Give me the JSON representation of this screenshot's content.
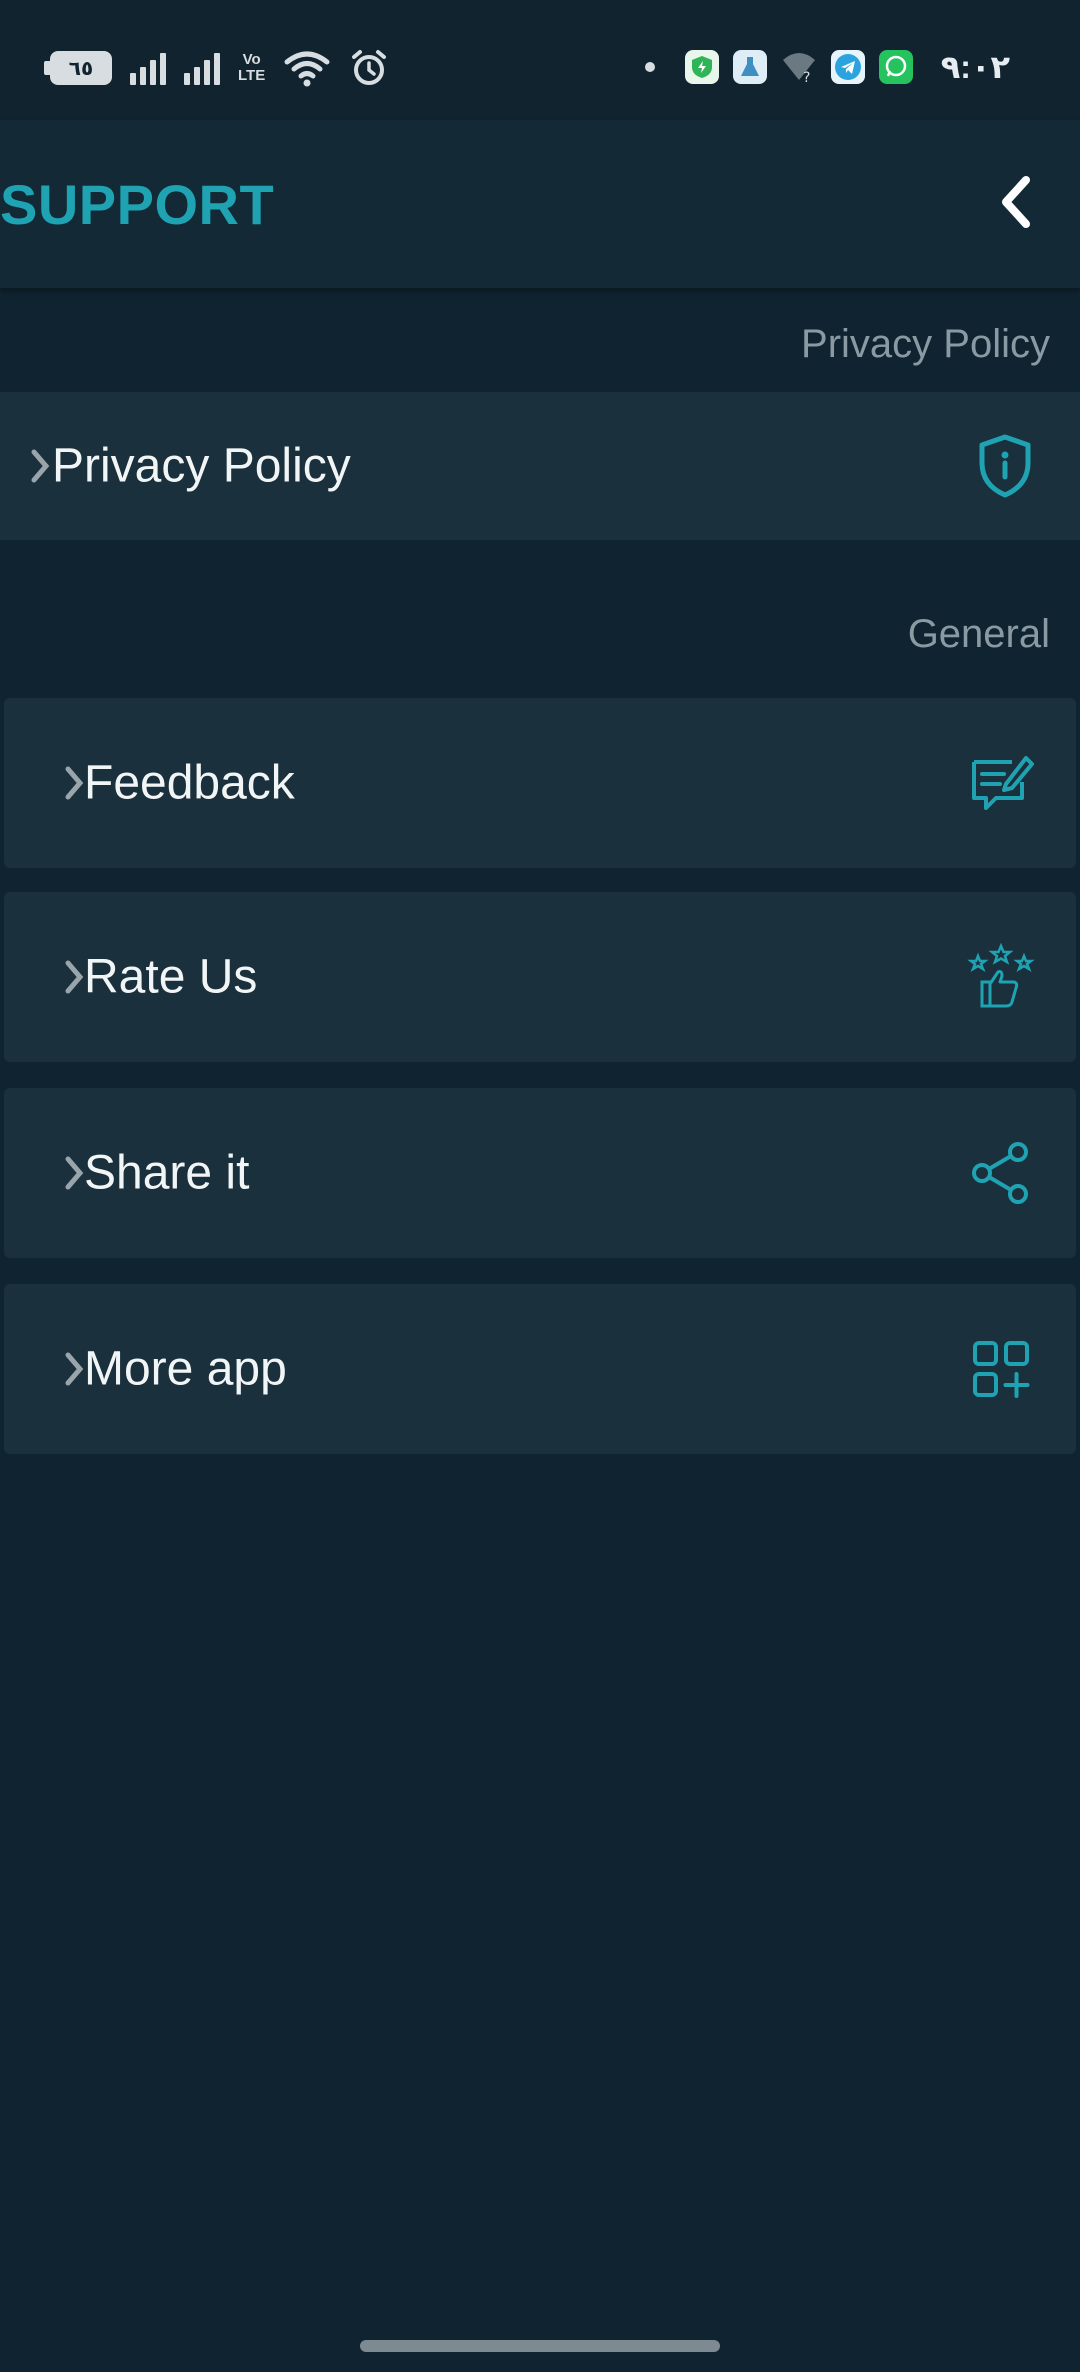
{
  "status_bar": {
    "battery_level": "٦٥",
    "volte_top": "Vo",
    "volte_bottom": "LTE",
    "time": "٩:٠٢"
  },
  "header": {
    "title": "SUPPORT"
  },
  "sections": {
    "privacy_label": "Privacy Policy",
    "general_label": "General"
  },
  "items": {
    "privacy": "Privacy Policy",
    "feedback": "Feedback",
    "rate": "Rate Us",
    "share": "Share it",
    "more": "More app"
  },
  "colors": {
    "accent": "#1fa3b3",
    "background": "#0f2330",
    "card": "#1a303c"
  }
}
